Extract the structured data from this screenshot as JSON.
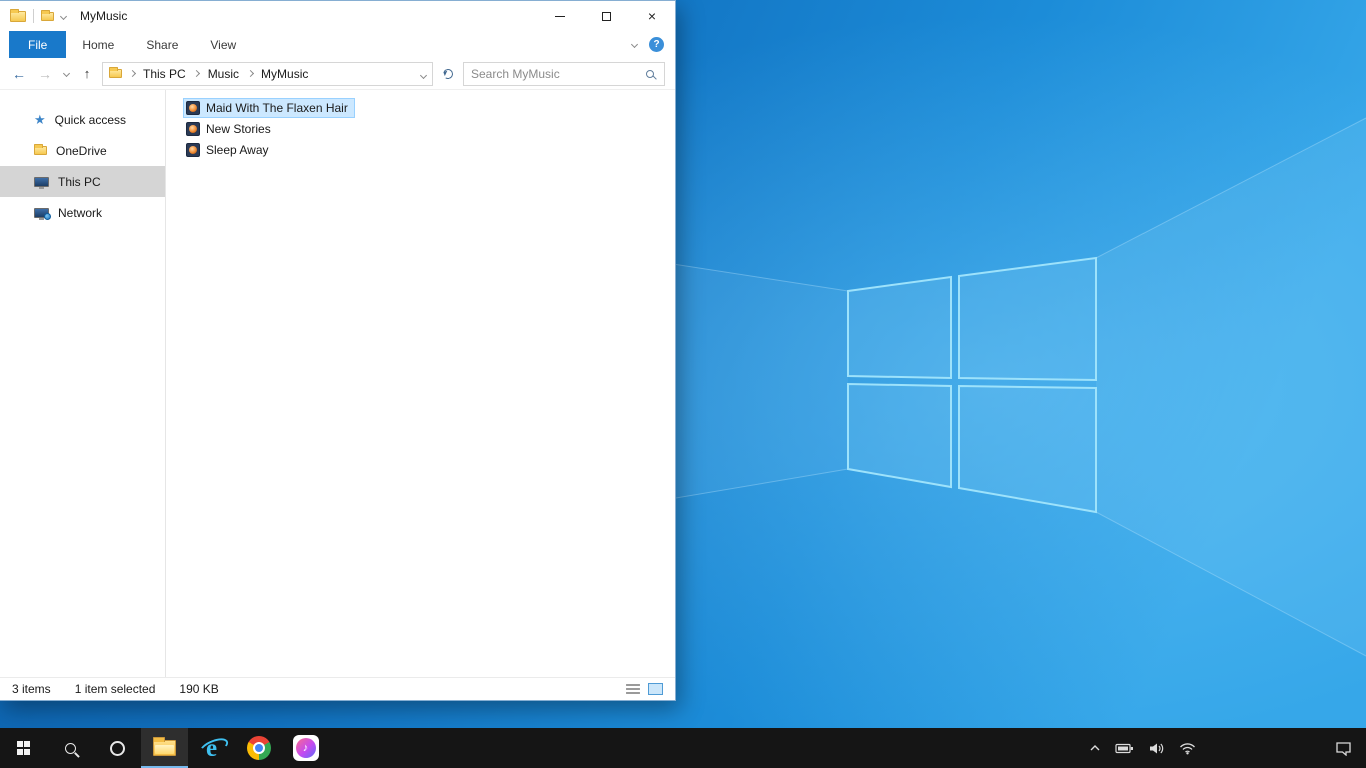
{
  "colors": {
    "accent_blue": "#1979ca",
    "selection_bg": "#cce8ff",
    "selection_border": "#99d1ff",
    "nav_selected_bg": "#d5d5d5",
    "taskbar_bg": "#151515",
    "wallpaper_base": [
      "#0b5aa3",
      "#1172c1",
      "#1c8cd8",
      "#36a7e9"
    ]
  },
  "icons": {
    "back": "←",
    "forward": "→",
    "up": "↑",
    "close": "×",
    "help": "?",
    "quick_access_star": "★",
    "music_note": "♪",
    "ie_letter": "e"
  },
  "explorer": {
    "title": "MyMusic",
    "tabs": [
      {
        "label": "File"
      },
      {
        "label": "Home"
      },
      {
        "label": "Share"
      },
      {
        "label": "View"
      }
    ],
    "breadcrumb": {
      "crumbs": [
        "This PC",
        "Music",
        "MyMusic"
      ]
    },
    "search": {
      "placeholder": "Search MyMusic"
    },
    "nav": {
      "items": [
        {
          "label": "Quick access"
        },
        {
          "label": "OneDrive"
        },
        {
          "label": "This PC",
          "selected": true
        },
        {
          "label": "Network"
        }
      ]
    },
    "files": [
      {
        "name": "Maid With The Flaxen Hair",
        "selected": true
      },
      {
        "name": "New Stories",
        "selected": false
      },
      {
        "name": "Sleep Away",
        "selected": false
      }
    ],
    "status": {
      "count": "3 items",
      "selection": "1 item selected",
      "size": "190 KB"
    }
  },
  "taskbar": {
    "buttons": [
      "start",
      "search",
      "cortana",
      "file-explorer",
      "internet-explorer",
      "chrome",
      "itunes"
    ],
    "active_button": "file-explorer",
    "tray": [
      "show-hidden-icons",
      "battery",
      "volume",
      "wifi",
      "action-center"
    ]
  }
}
